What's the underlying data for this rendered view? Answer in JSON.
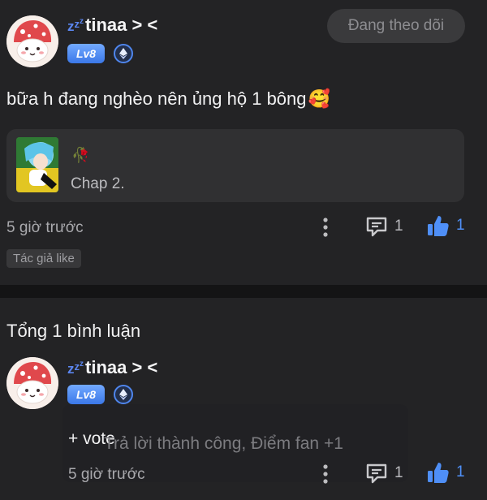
{
  "post": {
    "author": {
      "name": "tinaa > <",
      "level": "Lv8",
      "zzz": "zzz"
    },
    "follow_button": "Đang theo dõi",
    "content": "bữa h đang nghèo nên ủng hộ 1 bông",
    "content_emoji": "🥰",
    "chapter": {
      "flower_emoji": "🥀",
      "label": "Chap 2."
    },
    "time": "5 giờ trước",
    "comment_count": "1",
    "like_count": "1",
    "author_like_tag": "Tác giả like"
  },
  "comments_section": {
    "total_label": "Tổng 1 bình luận"
  },
  "reply": {
    "author": {
      "name": "tinaa > <",
      "level": "Lv8"
    },
    "vote_label": "+ vote",
    "toast_text": "Trả lời thành công, Điểm fan +1",
    "time": "5 giờ trước",
    "comment_count": "1",
    "like_count": "1"
  },
  "colors": {
    "background": "#232325",
    "accent_blue": "#4f8ff7",
    "level_badge": "#4a86f0"
  },
  "icons": [
    "avatar-mascot",
    "zzz-icon",
    "level-badge",
    "ethereum-badge-icon",
    "more-vertical-icon",
    "comment-icon",
    "thumbs-up-icon"
  ]
}
